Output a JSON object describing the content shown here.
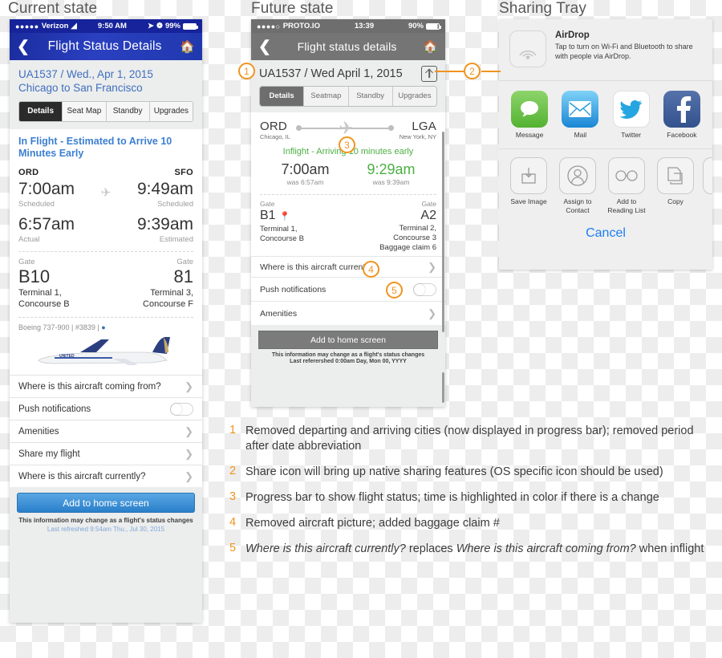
{
  "sections": {
    "current": "Current state",
    "future": "Future state",
    "tray": "Sharing Tray"
  },
  "current_phone": {
    "statusbar": {
      "carrier": "Verizon",
      "time": "9:50 AM",
      "battery": "99%"
    },
    "navbar": {
      "title": "Flight Status Details",
      "back_icon": "chevron-left-icon",
      "home_icon": "home-icon"
    },
    "flight_line": "UA1537 / Wed., Apr 1, 2015",
    "route_line": "Chicago to San Francisco",
    "tabs": [
      {
        "label": "Details",
        "active": true
      },
      {
        "label": "Seat Map",
        "active": false
      },
      {
        "label": "Standby",
        "active": false
      },
      {
        "label": "Upgrades",
        "active": false
      }
    ],
    "status_headline": "In Flight - Estimated to Arrive 10 Minutes Early",
    "origin": {
      "code": "ORD",
      "scheduled_time": "7:00am",
      "scheduled_label": "Scheduled",
      "actual_time": "6:57am",
      "actual_label": "Actual",
      "gate_label": "Gate",
      "gate": "B10",
      "terminal": "Terminal 1,\nConcourse B"
    },
    "destination": {
      "code": "SFO",
      "scheduled_time": "9:49am",
      "scheduled_label": "Scheduled",
      "actual_time": "9:39am",
      "actual_label": "Estimated",
      "gate_label": "Gate",
      "gate": "81",
      "terminal": "Terminal 3,\nConcourse F"
    },
    "aircraft_info": "Boeing 737-900 | #3839 |",
    "list_items": [
      {
        "label": "Where is this aircraft coming from?",
        "control": "chevron"
      },
      {
        "label": "Push notifications",
        "control": "toggle"
      },
      {
        "label": "Amenities",
        "control": "chevron"
      },
      {
        "label": "Share my flight",
        "control": "chevron"
      },
      {
        "label": "Where is this aircraft currently?",
        "control": "chevron"
      }
    ],
    "cta": "Add to home screen",
    "footer_line1": "This information may change as a flight's status changes",
    "footer_line2": "Last refreshed 9:54am Thu., Jul 30, 2015"
  },
  "future_phone": {
    "statusbar": {
      "carrier": "PROTO.IO",
      "time": "13:39",
      "battery": "90%"
    },
    "navbar": {
      "title": "Flight status details",
      "back_icon": "chevron-left-icon",
      "home_icon": "home-icon"
    },
    "flight_line": "UA1537 / Wed April 1, 2015",
    "share_icon": "share-up-icon",
    "tabs": [
      {
        "label": "Details",
        "active": true
      },
      {
        "label": "Seatmap",
        "active": false
      },
      {
        "label": "Standby",
        "active": false
      },
      {
        "label": "Upgrades",
        "active": false
      }
    ],
    "progress": {
      "origin_code": "ORD",
      "origin_city": "Chicago, IL",
      "dest_code": "LGA",
      "dest_city": "New York, NY",
      "plane_icon": "airplane-icon"
    },
    "status_headline": "Inflight - Arriving 10 minutes early",
    "status_color": "#4caf43",
    "origin": {
      "time": "7:00am",
      "was": "was 6:57am",
      "gate_label": "Gate",
      "gate": "B1",
      "pin_icon": "map-pin-icon",
      "terminal": "Terminal 1,\nConcourse B"
    },
    "destination": {
      "time": "9:29am",
      "was": "was 9:39am",
      "gate_label": "Gate",
      "gate": "A2",
      "terminal": "Terminal 2,\nConcourse 3\nBaggage claim 6"
    },
    "list_items": [
      {
        "label": "Where is this aircraft currently?",
        "control": "chevron"
      },
      {
        "label": "Push notifications",
        "control": "toggle"
      },
      {
        "label": "Amenities",
        "control": "chevron"
      }
    ],
    "cta": "Add to home screen",
    "footer_line1": "This information may change as a flight's status changes",
    "footer_line2": "Last referershed 0:00am Day, Mon 00, YYYY"
  },
  "sharing_tray": {
    "airdrop": {
      "icon": "airdrop-icon",
      "title": "AirDrop",
      "subtitle": "Tap to turn on Wi-Fi and Bluetooth to share with people via AirDrop."
    },
    "apps": [
      {
        "label": "Message",
        "icon": "message-bubble-icon",
        "color": "#6ac04b"
      },
      {
        "label": "Mail",
        "icon": "envelope-icon",
        "color": "#2e9fe0"
      },
      {
        "label": "Twitter",
        "icon": "twitter-bird-icon",
        "color": "#ffffff"
      },
      {
        "label": "Facebook",
        "icon": "facebook-f-icon",
        "color": "#3b5998"
      }
    ],
    "actions": [
      {
        "label": "Save Image",
        "icon": "download-box-icon"
      },
      {
        "label": "Assign to Contact",
        "icon": "person-circle-icon"
      },
      {
        "label": "Add to Reading List",
        "icon": "glasses-icon"
      },
      {
        "label": "Copy",
        "icon": "copy-pages-icon"
      },
      {
        "label": "",
        "icon": "partial-icon"
      }
    ],
    "cancel": "Cancel"
  },
  "callouts": [
    {
      "num": "1"
    },
    {
      "num": "2"
    },
    {
      "num": "3"
    },
    {
      "num": "4"
    },
    {
      "num": "5"
    }
  ],
  "notes": [
    {
      "num": "1",
      "text": "Removed departing and arriving cities (now displayed in progress bar); removed period after date abbreviation"
    },
    {
      "num": "2",
      "text": "Share icon will bring up native sharing features (OS specific icon should be used)"
    },
    {
      "num": "3",
      "text": "Progress bar to show flight status; time is highlighted in color if there is a change"
    },
    {
      "num": "4",
      "text": "Removed aircraft picture; added baggage claim #"
    },
    {
      "num": "5",
      "text_parts": [
        {
          "text": "Where is this aircraft currently?",
          "italic": true
        },
        {
          "text": " replaces ",
          "italic": false
        },
        {
          "text": "Where is this aircraft coming from?",
          "italic": true
        },
        {
          "text": " when inflight",
          "italic": false
        }
      ]
    }
  ],
  "colors": {
    "accent_orange": "#f0941f",
    "current_blue": "#16239a",
    "link_blue": "#3c7fd0",
    "future_gray": "#6e6e6e",
    "green": "#4caf43"
  }
}
